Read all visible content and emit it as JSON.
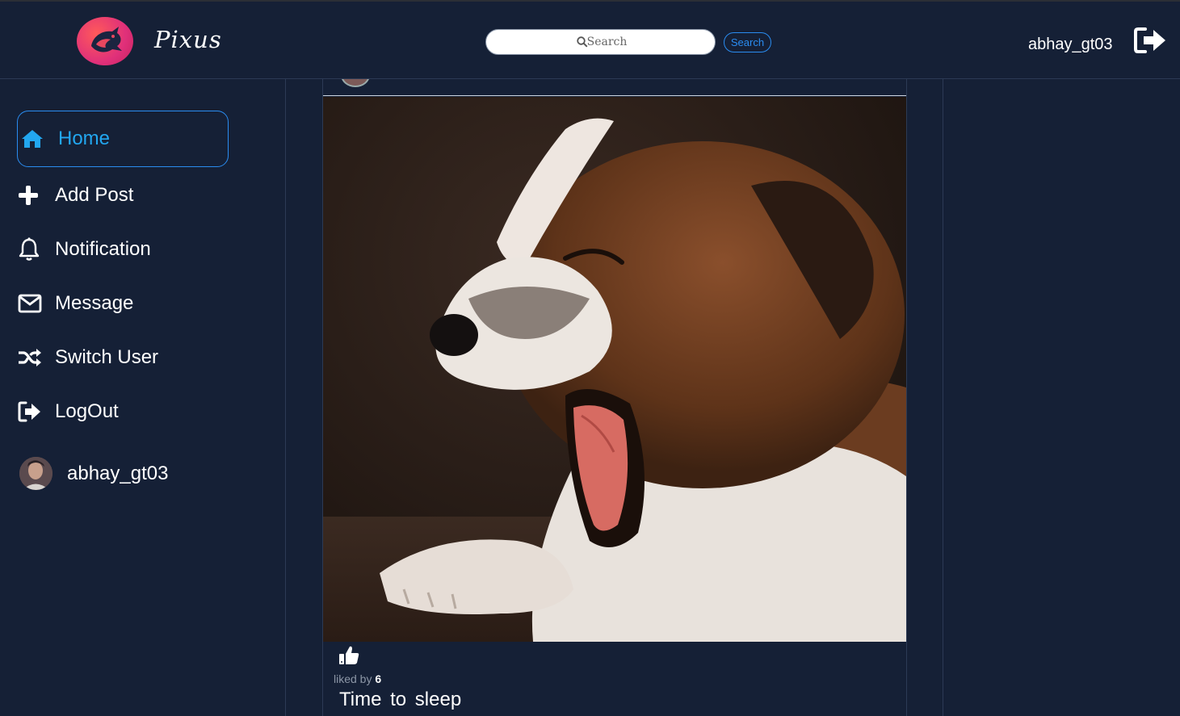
{
  "brand": {
    "name": "Pixus",
    "logo_icon": "dragon-logo-icon"
  },
  "search": {
    "placeholder": "Search",
    "button_label": "Search"
  },
  "header": {
    "username": "abhay_gt03",
    "logout_icon": "sign-out-icon"
  },
  "sidebar": {
    "items": [
      {
        "label": "Home",
        "icon": "home-icon",
        "active": true
      },
      {
        "label": "Add Post",
        "icon": "plus-icon"
      },
      {
        "label": "Notification",
        "icon": "bell-icon"
      },
      {
        "label": "Message",
        "icon": "envelope-icon"
      },
      {
        "label": "Switch User",
        "icon": "shuffle-icon"
      },
      {
        "label": "LogOut",
        "icon": "sign-out-icon"
      }
    ],
    "user": {
      "name": "abhay_gt03"
    }
  },
  "post": {
    "liked_by_label": "liked by",
    "likes": "6",
    "caption": "Time to sleep"
  },
  "colors": {
    "background": "#152036",
    "accent": "#2a8cf0",
    "active_nav": "#22a7f0"
  }
}
